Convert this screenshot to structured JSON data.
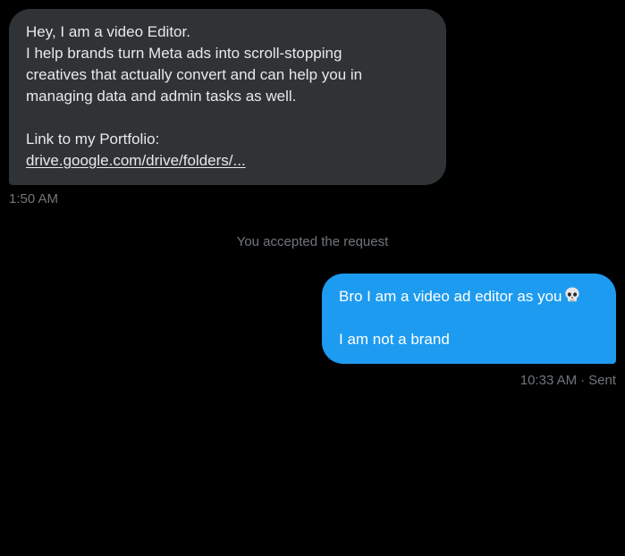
{
  "received_message": {
    "lines": [
      "Hey, I am a video Editor.",
      "I help brands turn Meta ads into scroll-stopping",
      "creatives that actually convert and can help you in",
      "managing data and admin tasks as well."
    ],
    "portfolio_label": "Link to my Portfolio:",
    "link_text": "drive.google.com/drive/folders/...",
    "time": "1:50 AM"
  },
  "system_message": "You accepted the request",
  "sent_message": {
    "line1": "Bro I am a video ad editor as you",
    "emoji": "skull-icon",
    "line2": "I am not a brand",
    "time": "10:33 AM",
    "separator": "·",
    "status": "Sent"
  },
  "colors": {
    "background": "#000000",
    "received_bubble": "#2f3336",
    "sent_bubble": "#1d9bf0",
    "muted_text": "#71767b",
    "text": "#e7e9ea"
  }
}
